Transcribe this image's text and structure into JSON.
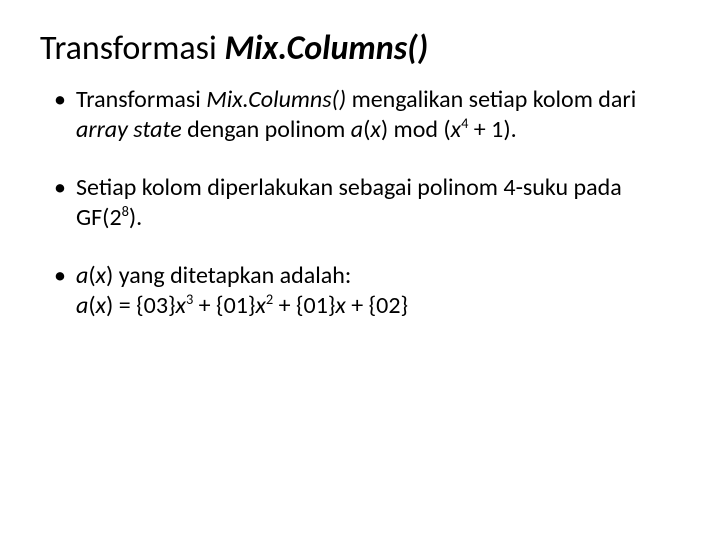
{
  "title": {
    "part1": "Transformasi ",
    "part2": "Mix.Columns()"
  },
  "bullets": {
    "b1": {
      "pre": "Transformasi ",
      "mix": "Mix.Columns()",
      "mid1": " mengalikan setiap kolom dari ",
      "arraystate": "array state",
      "mid2": " dengan polinom ",
      "a": "a",
      "paren_open": "(",
      "x": "x",
      "paren_close": ")",
      "mod": " mod (",
      "x2": "x",
      "exp4": "4",
      "tail": " + 1)."
    },
    "b2": {
      "text1": "Setiap kolom diperlakukan sebagai polinom 4-suku pada GF(2",
      "exp8": "8",
      "text2": ")."
    },
    "b3": {
      "a": "a",
      "paren_open": "(",
      "x": "x",
      "paren_close": ")",
      "line1_tail": " yang ditetapkan adalah:",
      "a2": "a",
      "paren_open2": "(",
      "x2": "x",
      "paren_close2": ")",
      "eq": " = {03}",
      "x3": "x",
      "exp3": "3",
      "plus1": " + {01}",
      "x4": "x",
      "exp2": "2",
      "plus2": " + {01}",
      "x5": "x",
      "plus3": " + {02}"
    }
  }
}
